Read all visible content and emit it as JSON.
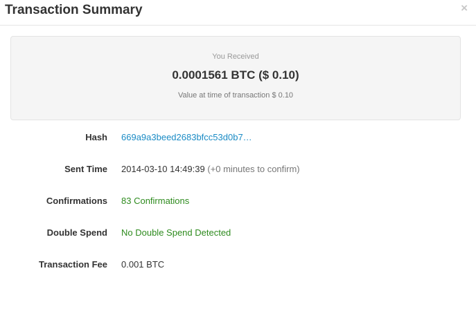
{
  "modal": {
    "title": "Transaction Summary",
    "close_symbol": "×"
  },
  "summary": {
    "received_label": "You Received",
    "amount": "0.0001561 BTC ($ 0.10)",
    "value_note": "Value at time of transaction $ 0.10"
  },
  "details": {
    "hash": {
      "label": "Hash",
      "value": "669a9a3beed2683bfcc53d0b7…"
    },
    "sent_time": {
      "label": "Sent Time",
      "value": "2014-03-10 14:49:39",
      "note": "(+0 minutes to confirm)"
    },
    "confirmations": {
      "label": "Confirmations",
      "value": "83 Confirmations"
    },
    "double_spend": {
      "label": "Double Spend",
      "value": "No Double Spend Detected"
    },
    "fee": {
      "label": "Transaction Fee",
      "value": "0.001 BTC"
    }
  },
  "colors": {
    "link": "#1a8bc5",
    "success": "#2e8b1e",
    "muted": "#777777",
    "panel_bg": "#f5f5f5"
  }
}
